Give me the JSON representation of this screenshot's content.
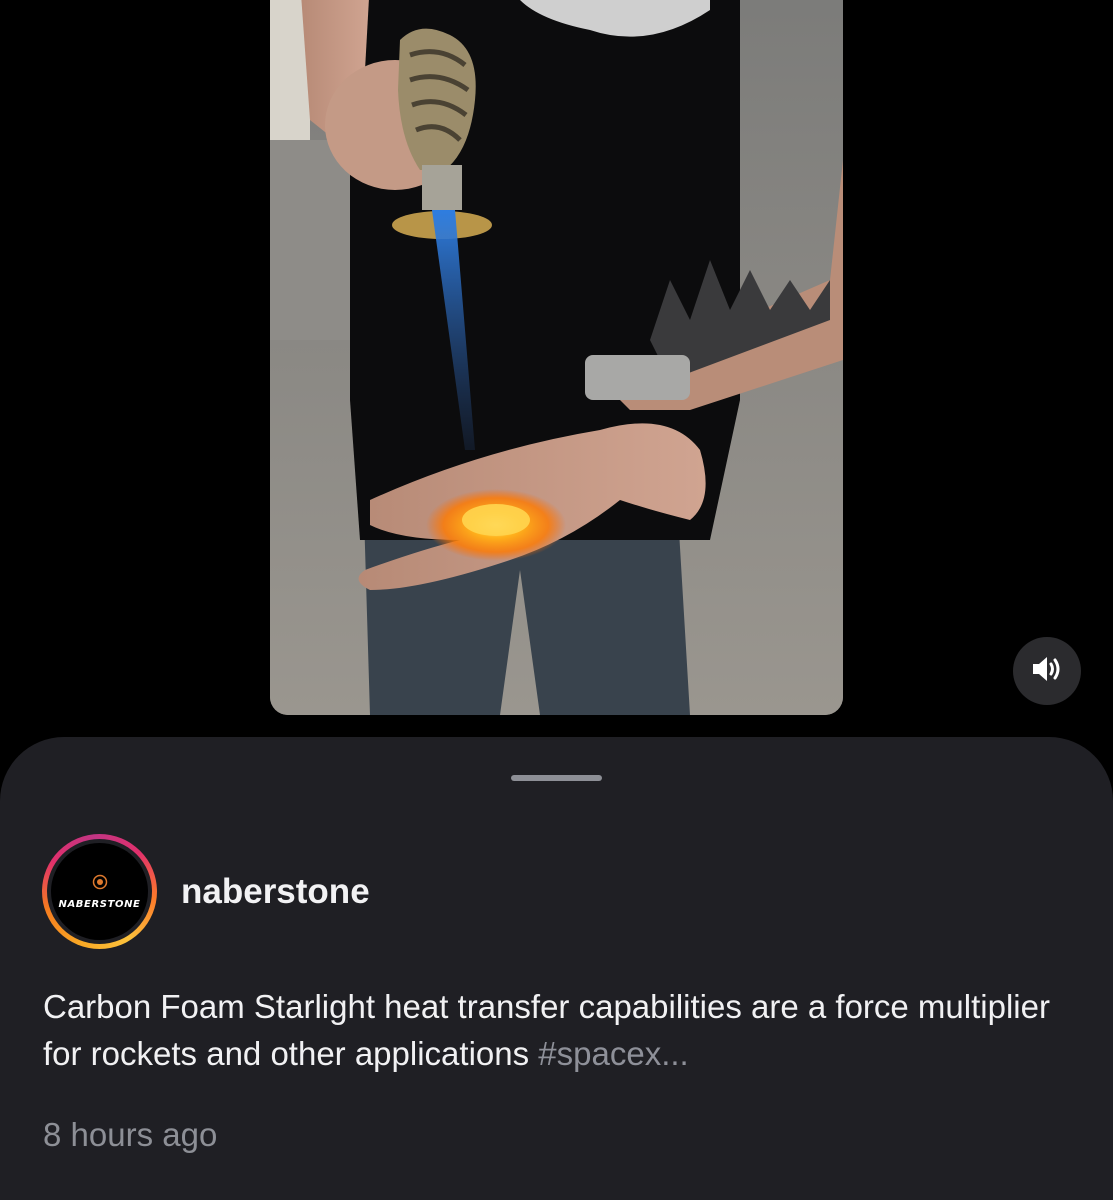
{
  "post": {
    "username": "naberstone",
    "avatar_logo_text": "NABERSTONE",
    "caption_text": "Carbon Foam Starlight heat transfer capabilities are a force multiplier for rockets and other applications ",
    "caption_hashtag": "#spacex",
    "caption_ellipsis": "...",
    "timestamp": "8 hours ago"
  },
  "video": {
    "content_icon": "video-frame",
    "sound_icon": "speaker-on-icon"
  },
  "colors": {
    "background": "#000000",
    "sheet": "#1f1f24",
    "text_primary": "#f1f1f3",
    "text_secondary": "#8d8f96",
    "story_ring_start": "#f9a825",
    "story_ring_end": "#c13584"
  }
}
